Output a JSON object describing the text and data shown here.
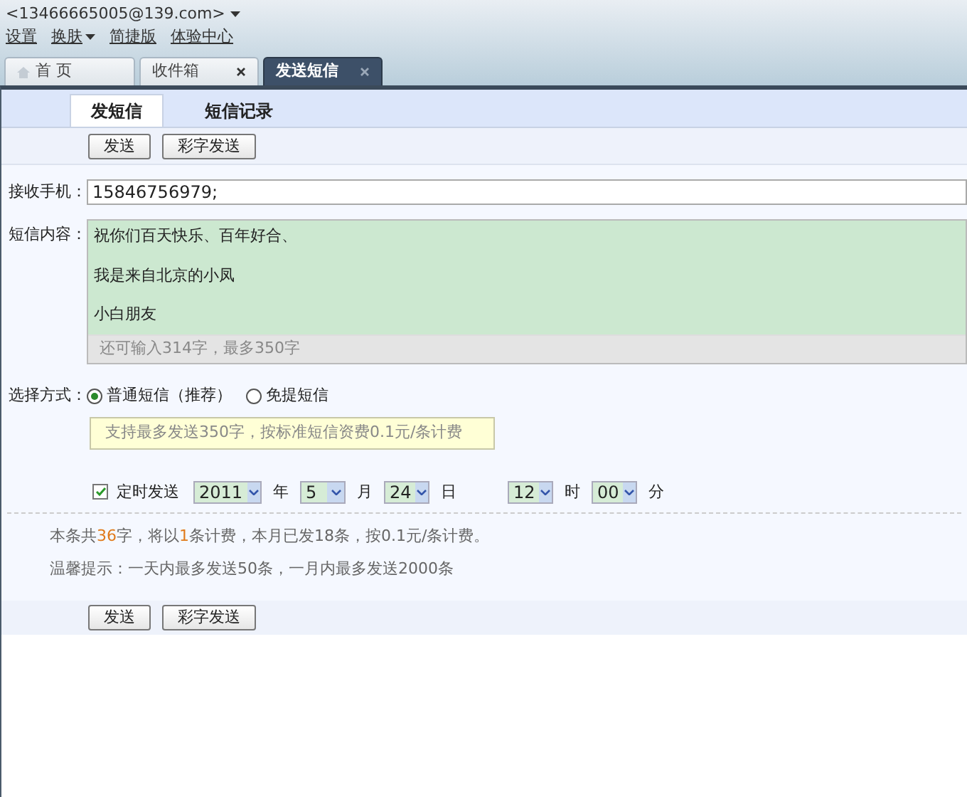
{
  "account": {
    "email": "<13466665005@139.com>"
  },
  "top_links": [
    {
      "label": "设置",
      "dropdown": false
    },
    {
      "label": "换肤",
      "dropdown": true
    },
    {
      "label": "简捷版",
      "dropdown": false
    },
    {
      "label": "体验中心",
      "dropdown": false
    }
  ],
  "tabs": [
    {
      "label": "首 页",
      "kind": "home",
      "selected": false,
      "closable": false
    },
    {
      "label": "收件箱",
      "kind": "page",
      "selected": false,
      "closable": true
    },
    {
      "label": "发送短信",
      "kind": "page",
      "selected": true,
      "closable": true
    }
  ],
  "sub_tabs": [
    {
      "label": "发短信",
      "selected": true
    },
    {
      "label": "短信记录",
      "selected": false
    }
  ],
  "top_buttons": [
    "发送",
    "彩字发送"
  ],
  "recipient": {
    "label": "接收手机：",
    "value": "15846756979;"
  },
  "content": {
    "label": "短信内容：",
    "lines": [
      "祝你们百天快乐、百年好合、",
      "我是来自北京的小凤",
      "小白朋友"
    ],
    "counter": "还可输入314字，最多350字"
  },
  "mode": {
    "label": "选择方式：",
    "options": [
      {
        "label": "普通短信（推荐）",
        "selected": true
      },
      {
        "label": "免提短信",
        "selected": false
      }
    ],
    "tip": "支持最多发送350字，按标准短信资费0.1元/条计费"
  },
  "schedule": {
    "label": "定时发送",
    "checked": true,
    "fields": [
      {
        "value": "2011",
        "unit": "年"
      },
      {
        "value": "5",
        "unit": "月"
      },
      {
        "value": "24",
        "unit": "日"
      },
      {
        "value": "12",
        "unit": "时"
      },
      {
        "value": "00",
        "unit": "分"
      }
    ]
  },
  "summary": [
    {
      "text": "本条共",
      "highlight": false
    },
    {
      "text": "36",
      "highlight": true
    },
    {
      "text": "字，将以",
      "highlight": false
    },
    {
      "text": "1",
      "highlight": true
    },
    {
      "text": "条计费，本月已发18条，按0.1元/条计费。",
      "highlight": false
    }
  ],
  "hint": "温馨提示：一天内最多发送50条，一月内最多发送2000条",
  "bottom_buttons": [
    "发送",
    "彩字发送"
  ]
}
